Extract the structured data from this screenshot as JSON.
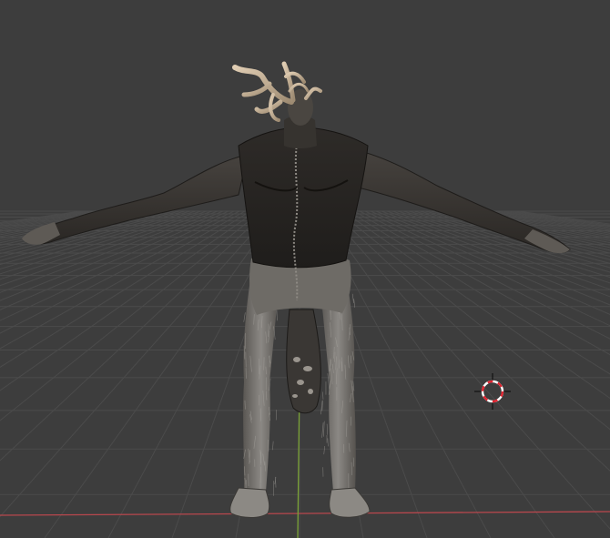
{
  "viewport": {
    "background_color": "#3d3d3d",
    "grid_color": "#4a4a4a",
    "x_axis_color": "#c0494f",
    "y_axis_color": "#7aa236",
    "cursor_colors": [
      "#ffffff",
      "#e0232f"
    ],
    "model": "creature-model"
  },
  "icons": {
    "cursor": "3d-cursor-icon"
  }
}
